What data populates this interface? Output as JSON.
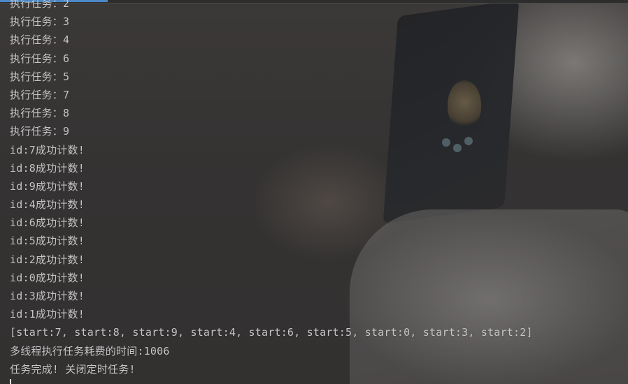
{
  "console": {
    "lines": [
      "执行任务：2",
      "执行任务：3",
      "执行任务：4",
      "执行任务：6",
      "执行任务：5",
      "执行任务：7",
      "执行任务：8",
      "执行任务：9",
      "id:7成功计数!",
      "id:8成功计数!",
      "id:9成功计数!",
      "id:4成功计数!",
      "id:6成功计数!",
      "id:5成功计数!",
      "id:2成功计数!",
      "id:0成功计数!",
      "id:3成功计数!",
      "id:1成功计数!",
      "[start:7, start:8, start:9, start:4, start:6, start:5, start:0, start:3, start:2]",
      "多线程执行任务耗费的时间:1006",
      "任务完成! 关闭定时任务!"
    ]
  },
  "colors": {
    "text": "#c7c7c7",
    "accent": "#4a88c7",
    "background": "#2b2b2b"
  }
}
